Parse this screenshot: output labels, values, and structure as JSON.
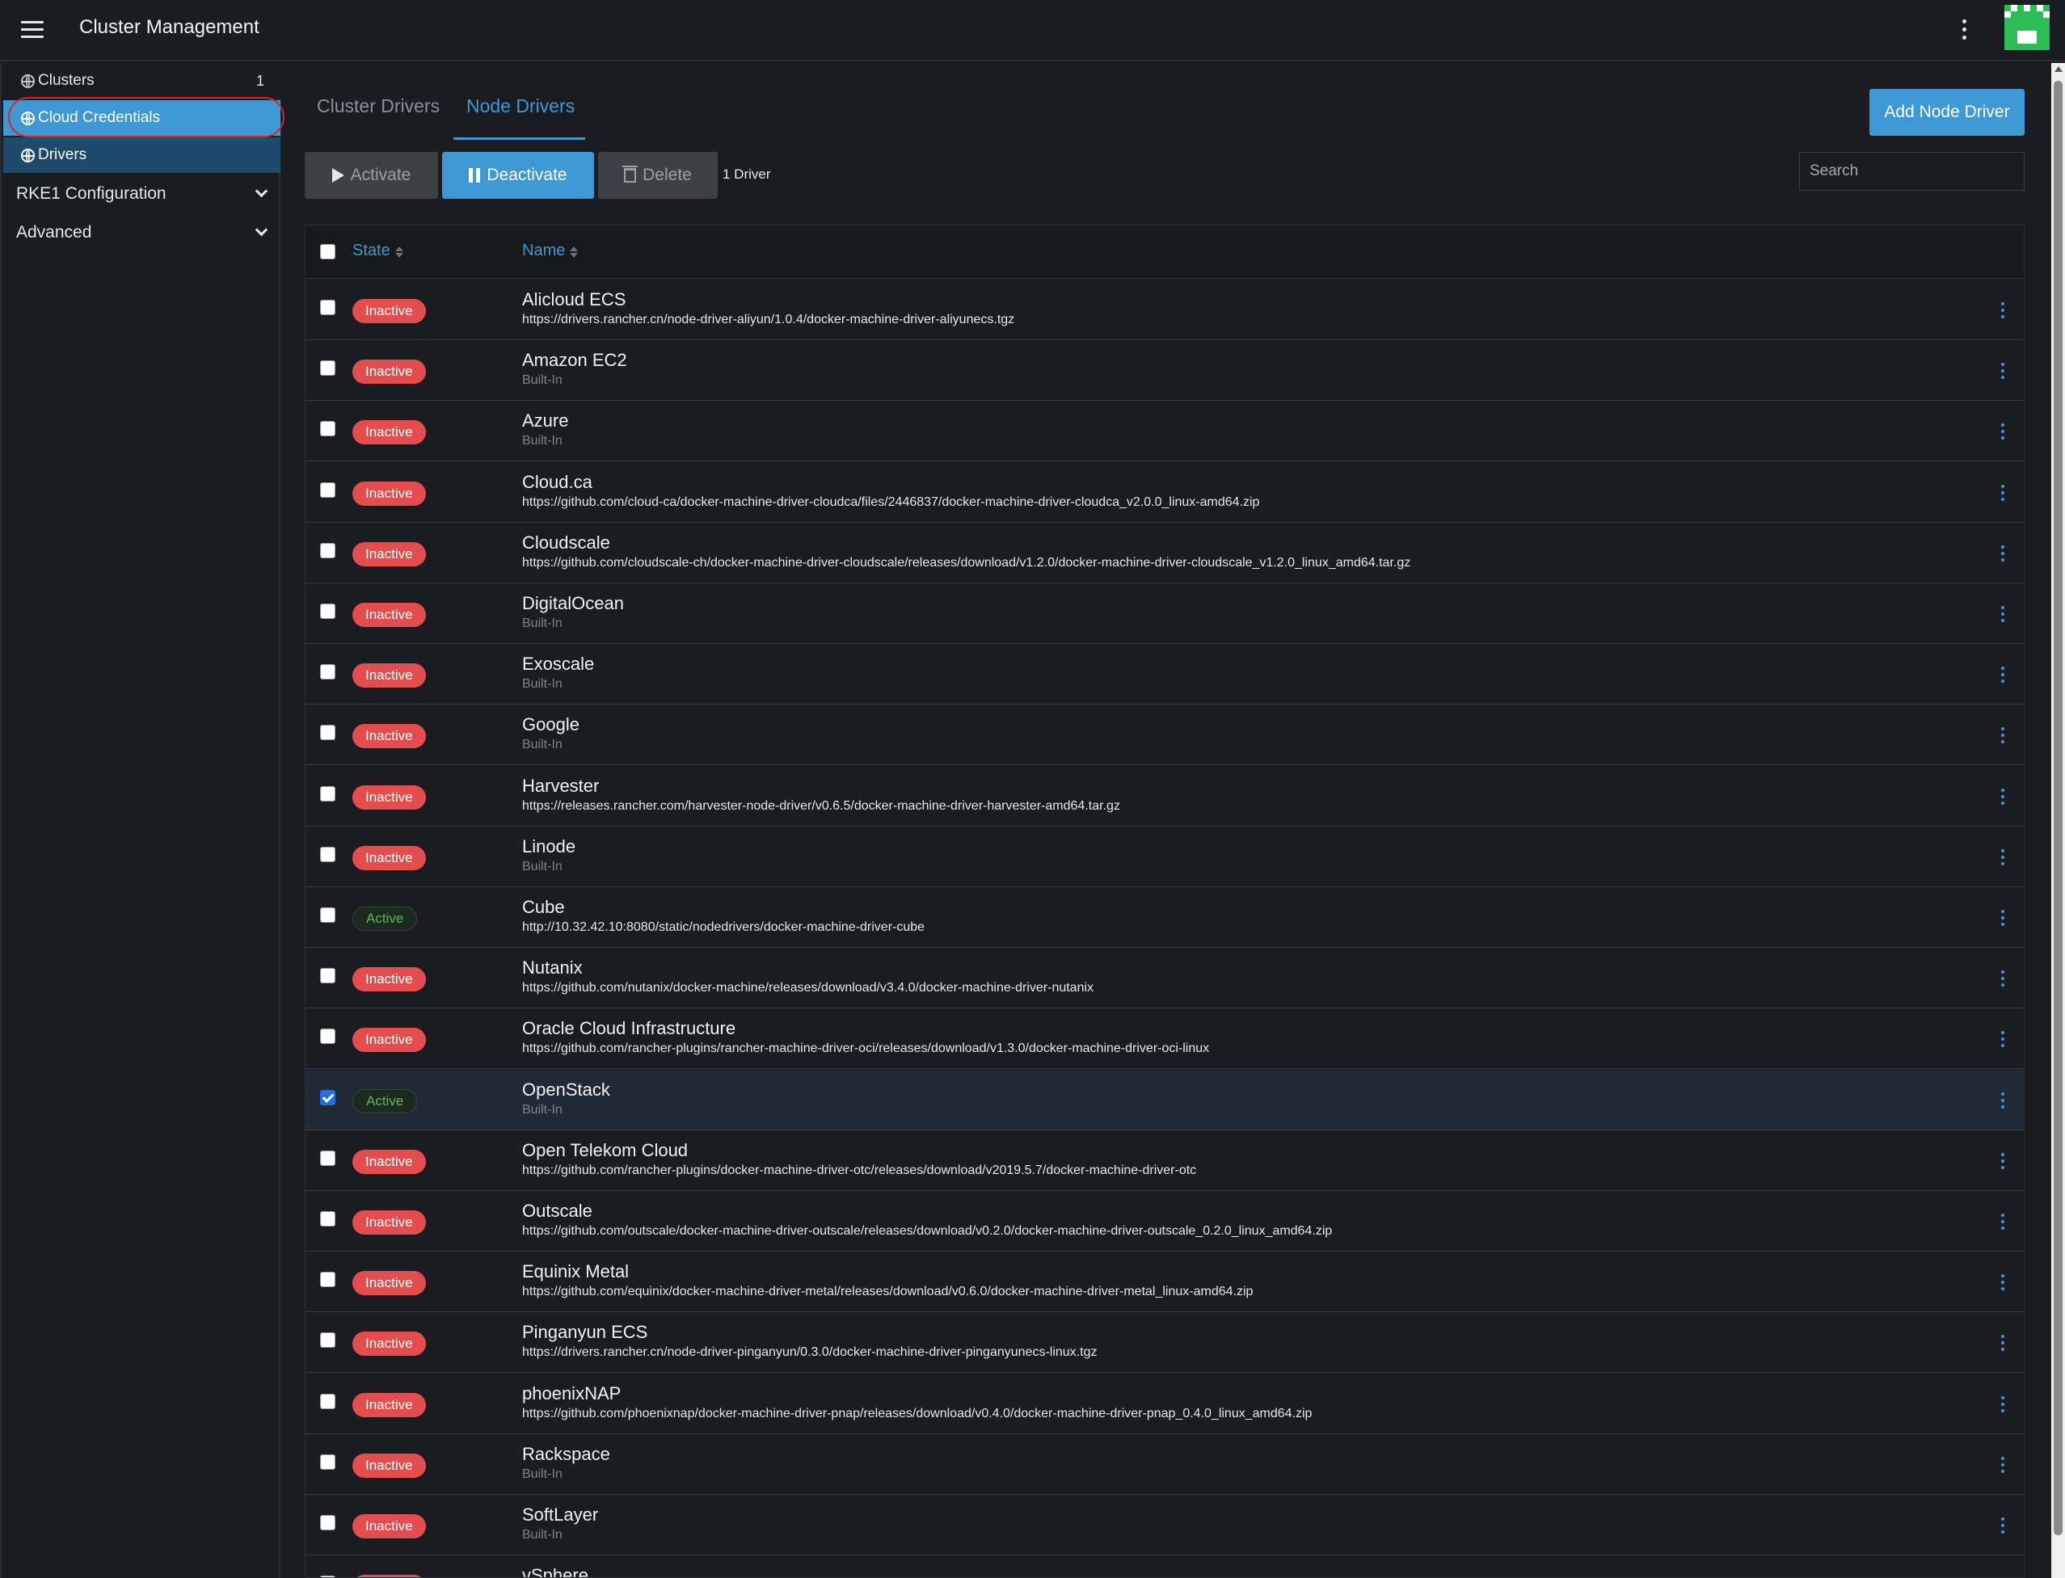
{
  "header": {
    "title": "Cluster Management",
    "menu_icon": "hamburger-icon",
    "more_icon": "kebab-vertical-icon",
    "avatar_icon": "user-avatar-icon"
  },
  "sidebar": {
    "clusters": {
      "label": "Clusters",
      "count": "1"
    },
    "cloud_credentials": {
      "label": "Cloud Credentials"
    },
    "drivers": {
      "label": "Drivers"
    },
    "groups": [
      {
        "label": "RKE1 Configuration"
      },
      {
        "label": "Advanced"
      }
    ]
  },
  "tabs": {
    "cluster_drivers": "Cluster Drivers",
    "node_drivers": "Node Drivers"
  },
  "toolbar": {
    "add_label": "Add Node Driver",
    "activate_label": "Activate",
    "deactivate_label": "Deactivate",
    "delete_label": "Delete",
    "selection_count": "1 Driver",
    "search_placeholder": "Search"
  },
  "table": {
    "columns": {
      "state": "State",
      "name": "Name"
    },
    "rows": [
      {
        "state": "Inactive",
        "name": "Alicloud ECS",
        "sub": "https://drivers.rancher.cn/node-driver-aliyun/1.0.4/docker-machine-driver-aliyunecs.tgz",
        "checked": false
      },
      {
        "state": "Inactive",
        "name": "Amazon EC2",
        "sub": "Built-In",
        "checked": false
      },
      {
        "state": "Inactive",
        "name": "Azure",
        "sub": "Built-In",
        "checked": false
      },
      {
        "state": "Inactive",
        "name": "Cloud.ca",
        "sub": "https://github.com/cloud-ca/docker-machine-driver-cloudca/files/2446837/docker-machine-driver-cloudca_v2.0.0_linux-amd64.zip",
        "checked": false
      },
      {
        "state": "Inactive",
        "name": "Cloudscale",
        "sub": "https://github.com/cloudscale-ch/docker-machine-driver-cloudscale/releases/download/v1.2.0/docker-machine-driver-cloudscale_v1.2.0_linux_amd64.tar.gz",
        "checked": false
      },
      {
        "state": "Inactive",
        "name": "DigitalOcean",
        "sub": "Built-In",
        "checked": false
      },
      {
        "state": "Inactive",
        "name": "Exoscale",
        "sub": "Built-In",
        "checked": false
      },
      {
        "state": "Inactive",
        "name": "Google",
        "sub": "Built-In",
        "checked": false
      },
      {
        "state": "Inactive",
        "name": "Harvester",
        "sub": "https://releases.rancher.com/harvester-node-driver/v0.6.5/docker-machine-driver-harvester-amd64.tar.gz",
        "checked": false
      },
      {
        "state": "Inactive",
        "name": "Linode",
        "sub": "Built-In",
        "checked": false
      },
      {
        "state": "Active",
        "name": "Cube",
        "sub": "http://10.32.42.10:8080/static/nodedrivers/docker-machine-driver-cube",
        "checked": false
      },
      {
        "state": "Inactive",
        "name": "Nutanix",
        "sub": "https://github.com/nutanix/docker-machine/releases/download/v3.4.0/docker-machine-driver-nutanix",
        "checked": false
      },
      {
        "state": "Inactive",
        "name": "Oracle Cloud Infrastructure",
        "sub": "https://github.com/rancher-plugins/rancher-machine-driver-oci/releases/download/v1.3.0/docker-machine-driver-oci-linux",
        "checked": false
      },
      {
        "state": "Active",
        "name": "OpenStack",
        "sub": "Built-In",
        "checked": true
      },
      {
        "state": "Inactive",
        "name": "Open Telekom Cloud",
        "sub": "https://github.com/rancher-plugins/docker-machine-driver-otc/releases/download/v2019.5.7/docker-machine-driver-otc",
        "checked": false
      },
      {
        "state": "Inactive",
        "name": "Outscale",
        "sub": "https://github.com/outscale/docker-machine-driver-outscale/releases/download/v0.2.0/docker-machine-driver-outscale_0.2.0_linux_amd64.zip",
        "checked": false
      },
      {
        "state": "Inactive",
        "name": "Equinix Metal",
        "sub": "https://github.com/equinix/docker-machine-driver-metal/releases/download/v0.6.0/docker-machine-driver-metal_linux-amd64.zip",
        "checked": false
      },
      {
        "state": "Inactive",
        "name": "Pinganyun ECS",
        "sub": "https://drivers.rancher.cn/node-driver-pinganyun/0.3.0/docker-machine-driver-pinganyunecs-linux.tgz",
        "checked": false
      },
      {
        "state": "Inactive",
        "name": "phoenixNAP",
        "sub": "https://github.com/phoenixnap/docker-machine-driver-pnap/releases/download/v0.4.0/docker-machine-driver-pnap_0.4.0_linux_amd64.zip",
        "checked": false
      },
      {
        "state": "Inactive",
        "name": "Rackspace",
        "sub": "Built-In",
        "checked": false
      },
      {
        "state": "Inactive",
        "name": "SoftLayer",
        "sub": "Built-In",
        "checked": false
      },
      {
        "state": "Inactive",
        "name": "vSphere",
        "sub": "",
        "checked": false
      }
    ]
  },
  "colors": {
    "accent": "#3d98d3",
    "inactive_badge": "#e44d4d",
    "active_text": "#5cb85c",
    "background": "#1b1c21",
    "highlight_ring": "#d9252a"
  }
}
